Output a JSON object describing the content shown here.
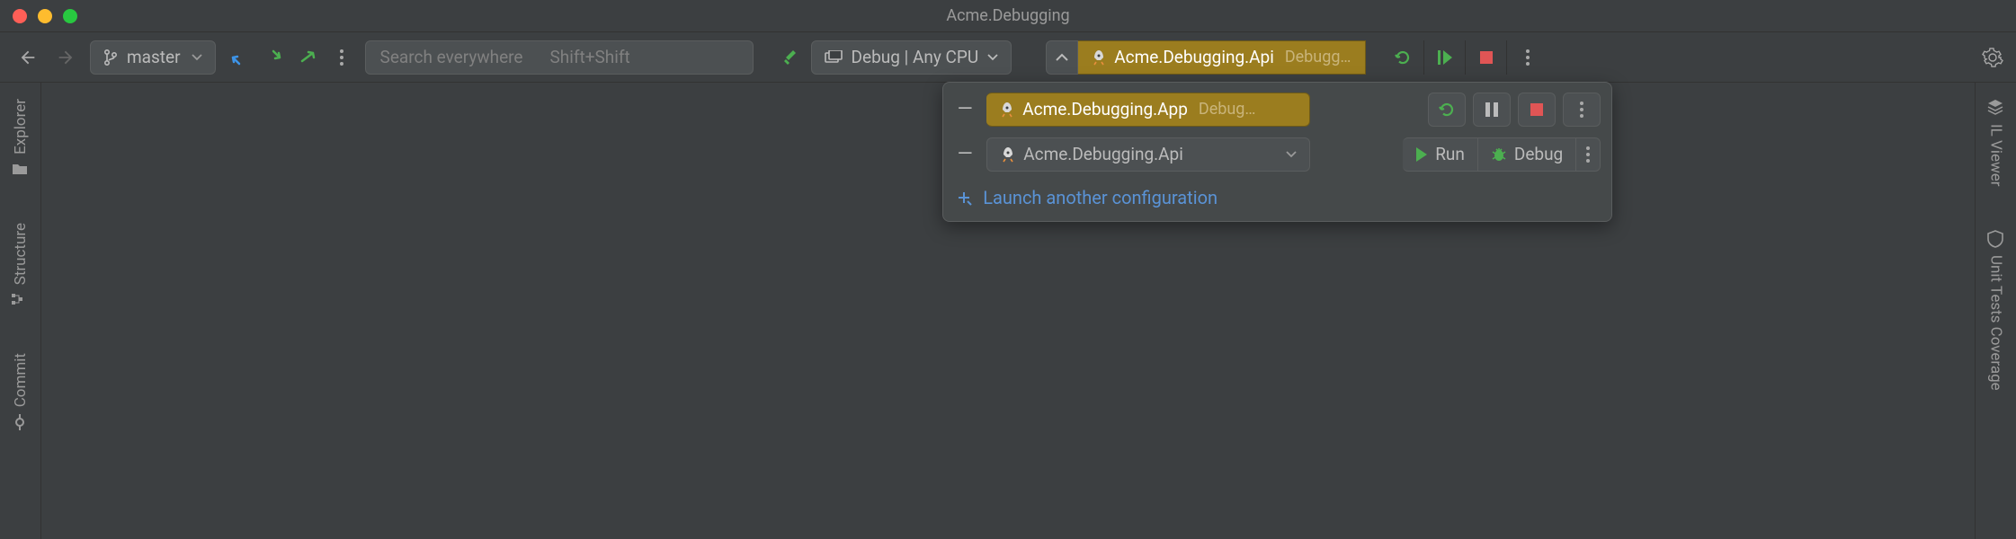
{
  "window": {
    "title": "Acme.Debugging"
  },
  "toolbar": {
    "branch": "master",
    "search_placeholder": "Search everywhere",
    "search_shortcut": "Shift+Shift",
    "configuration": "Debug | Any CPU"
  },
  "runWidget": {
    "primary": {
      "name": "Acme.Debugging.Api",
      "status": "Debugg…"
    },
    "rows": [
      {
        "name": "Acme.Debugging.App",
        "status": "Debug…"
      },
      {
        "name": "Acme.Debugging.Api"
      }
    ],
    "run_label": "Run",
    "debug_label": "Debug",
    "launch_another": "Launch another configuration"
  },
  "sidebar": {
    "left": [
      "Explorer",
      "Structure",
      "Commit"
    ],
    "right": [
      "IL Viewer",
      "Unit Tests Coverage"
    ]
  }
}
